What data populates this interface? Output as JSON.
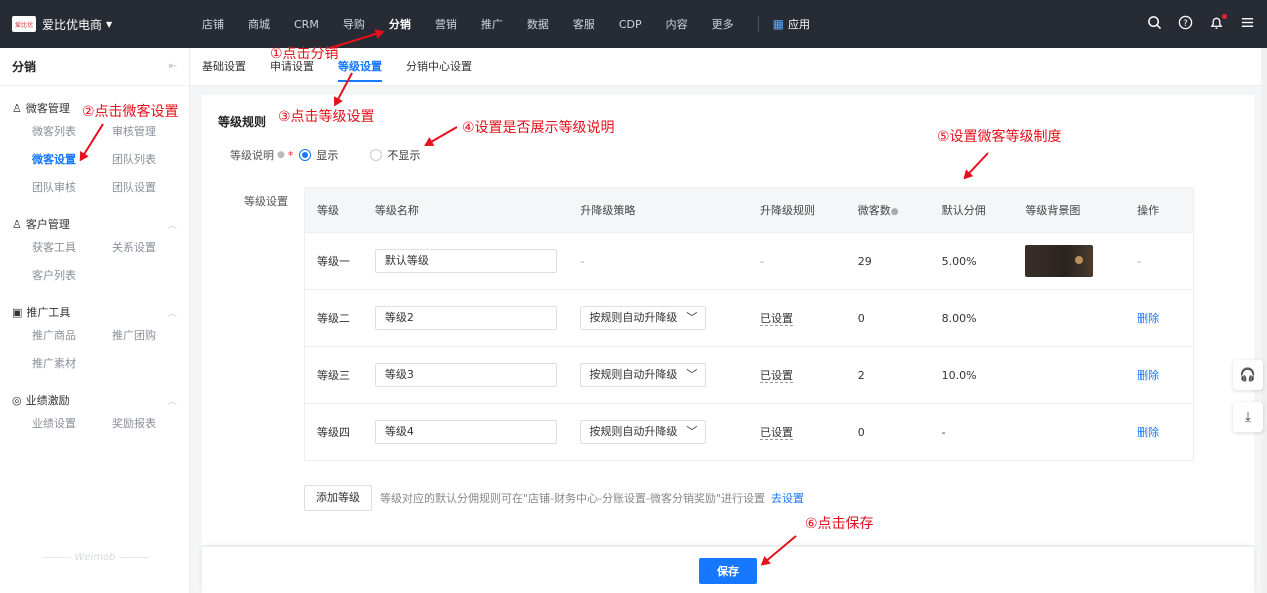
{
  "topbar": {
    "brand_logo": "爱比优",
    "brand_name": "爱比优电商",
    "nav": [
      "店铺",
      "商城",
      "CRM",
      "导购",
      "分销",
      "营销",
      "推广",
      "数据",
      "客服",
      "CDP",
      "内容",
      "更多"
    ],
    "nav_active_index": 4,
    "app_label": "应用"
  },
  "sidebar": {
    "title": "分销",
    "groups": [
      {
        "label": "微客管理",
        "items": [
          "微客列表",
          "审核管理",
          "微客设置",
          "团队列表",
          "团队审核",
          "团队设置"
        ],
        "active": 2
      },
      {
        "label": "客户管理",
        "items": [
          "获客工具",
          "关系设置",
          "客户列表"
        ]
      },
      {
        "label": "推广工具",
        "items": [
          "推广商品",
          "推广团购",
          "推广素材"
        ]
      },
      {
        "label": "业绩激励",
        "items": [
          "业绩设置",
          "奖励报表"
        ]
      }
    ],
    "footer": "Weimob"
  },
  "tabs": [
    "基础设置",
    "申请设置",
    "等级设置",
    "分销中心设置"
  ],
  "tabs_active_index": 2,
  "rule": {
    "title": "等级规则",
    "desc_label": "等级说明",
    "options": [
      "显示",
      "不显示"
    ],
    "selected": 0,
    "level_label": "等级设置"
  },
  "table": {
    "headers": [
      "等级",
      "等级名称",
      "升降级策略",
      "升降级规则",
      "微客数",
      "默认分佣",
      "等级背景图",
      "操作"
    ],
    "rows": [
      {
        "level": "等级一",
        "name": "默认等级",
        "strategy": "-",
        "rule": "-",
        "count": "29",
        "rate": "5.00%",
        "has_bg": true,
        "op": "-"
      },
      {
        "level": "等级二",
        "name": "等级2",
        "strategy": "按规则自动升降级",
        "rule": "已设置",
        "count": "0",
        "rate": "8.00%",
        "has_bg": false,
        "op": "删除"
      },
      {
        "level": "等级三",
        "name": "等级3",
        "strategy": "按规则自动升降级",
        "rule": "已设置",
        "count": "2",
        "rate": "10.0%",
        "has_bg": false,
        "op": "删除"
      },
      {
        "level": "等级四",
        "name": "等级4",
        "strategy": "按规则自动升降级",
        "rule": "已设置",
        "count": "0",
        "rate": "-",
        "has_bg": false,
        "op": "删除"
      }
    ]
  },
  "add": {
    "button": "添加等级",
    "hint": "等级对应的默认分佣规则可在\"店铺-财务中心-分账设置-微客分销奖励\"进行设置",
    "link": "去设置"
  },
  "save_label": "保存",
  "annotations": [
    "①点击分销",
    "②点击微客设置",
    "③点击等级设置",
    "④设置是否展示等级说明",
    "⑤设置微客等级制度",
    "⑥点击保存"
  ],
  "colors": {
    "accent": "#1677ff",
    "annotation": "#e5101d",
    "topbar": "#272b33"
  }
}
